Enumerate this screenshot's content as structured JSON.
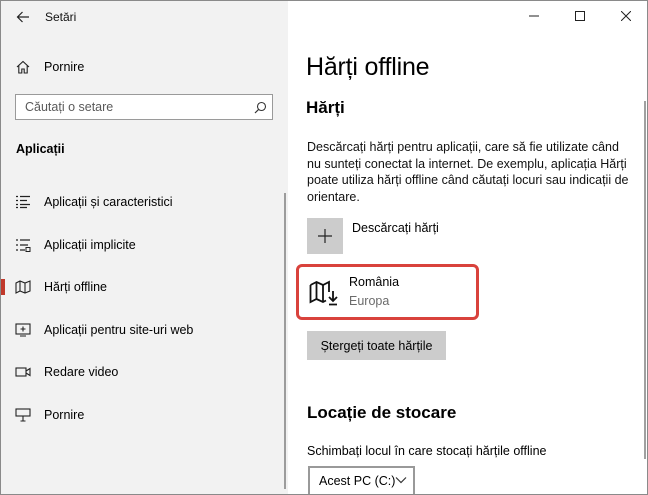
{
  "window": {
    "title": "Setări",
    "controls": [
      "minimize",
      "maximize",
      "close"
    ]
  },
  "sidebar": {
    "home_label": "Pornire",
    "search_placeholder": "Căutați o setare",
    "section_label": "Aplicații",
    "items": [
      {
        "label": "Aplicații și caracteristici",
        "icon": "apps-features-icon"
      },
      {
        "label": "Aplicații implicite",
        "icon": "default-apps-icon"
      },
      {
        "label": "Hărți offline",
        "icon": "offline-maps-icon",
        "active": true
      },
      {
        "label": "Aplicații pentru site-uri web",
        "icon": "apps-websites-icon"
      },
      {
        "label": "Redare video",
        "icon": "video-playback-icon"
      },
      {
        "label": "Pornire",
        "icon": "startup-icon"
      }
    ]
  },
  "main": {
    "page_title": "Hărți offline",
    "maps_heading": "Hărți",
    "description": "Descărcați hărți pentru aplicații, care să fie utilizate când nu sunteți conectat la internet. De exemplu, aplicația Hărți poate utiliza hărți offline când căutați locuri sau indicații de orientare.",
    "download_label": "Descărcați hărți",
    "downloaded_map": {
      "name": "România",
      "region": "Europa"
    },
    "delete_all_label": "Ștergeți toate hărțile",
    "storage_heading": "Locație de stocare",
    "storage_description": "Schimbați locul în care stocați hărțile offline",
    "storage_selected": "Acest PC (C:)"
  },
  "colors": {
    "accent": "#c0392b",
    "highlight_border": "#d9423c",
    "sidebar_bg": "#f2f2f2",
    "button_bg": "#cccccc"
  }
}
